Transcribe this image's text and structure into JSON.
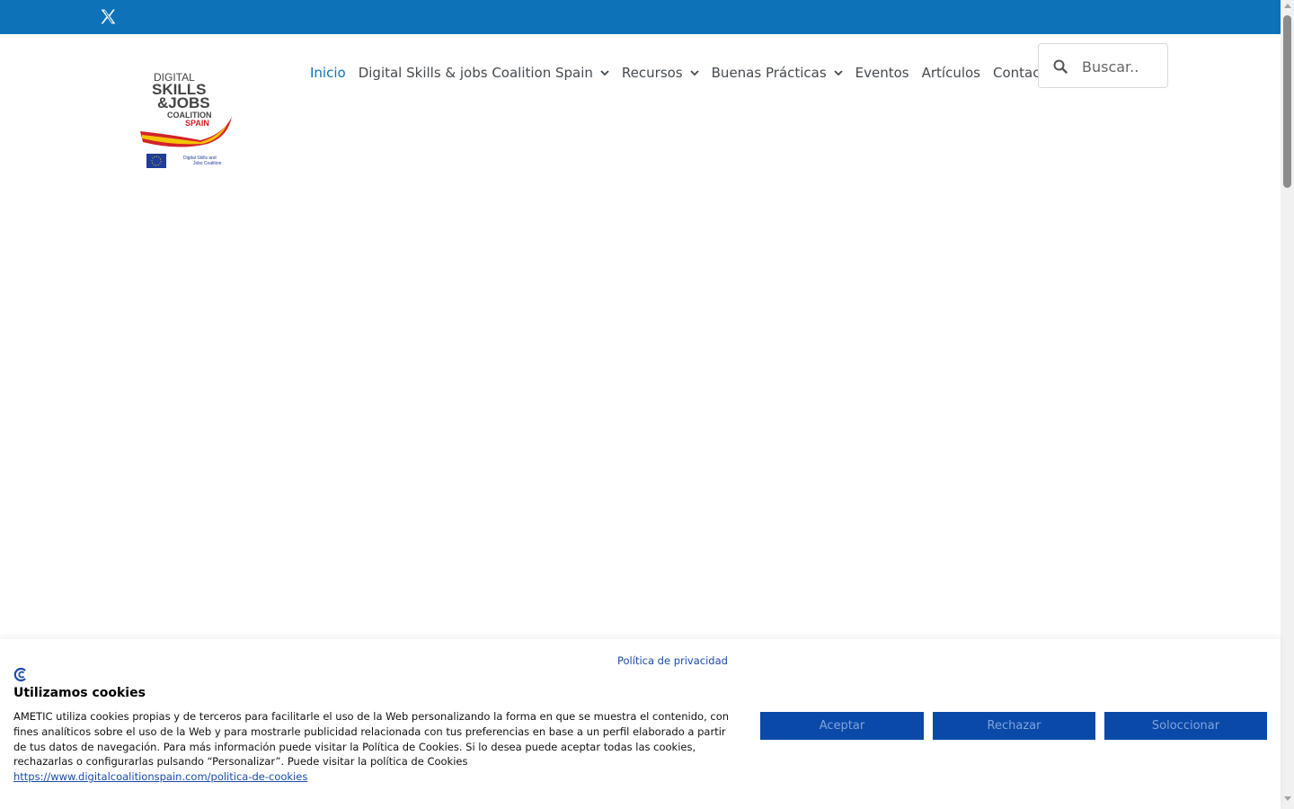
{
  "topbar": {
    "social_icon": "x-twitter-icon",
    "color": "#0e72b9"
  },
  "logo": {
    "line1": "DIGITAL",
    "line2": "SKILLS",
    "line3": "&JOBS",
    "line4": "COALITION",
    "line5": "SPAIN",
    "eu_caption_1": "Digital Skills and",
    "eu_caption_2": "Jobs Coalition"
  },
  "nav": {
    "items": [
      {
        "label": "Inicio",
        "active": true,
        "dropdown": false
      },
      {
        "label": "Digital Skills & jobs Coalition Spain",
        "active": false,
        "dropdown": true
      },
      {
        "label": "Recursos",
        "active": false,
        "dropdown": true
      },
      {
        "label": "Buenas Prácticas",
        "active": false,
        "dropdown": true
      },
      {
        "label": "Eventos",
        "active": false,
        "dropdown": false
      },
      {
        "label": "Artículos",
        "active": false,
        "dropdown": false
      },
      {
        "label": "Contacto",
        "active": false,
        "dropdown": false
      }
    ],
    "active_color": "#0e72b9"
  },
  "search": {
    "placeholder": "Buscar..",
    "value": ""
  },
  "cookie_banner": {
    "privacy_link": "Política de privacidad",
    "title": "Utilizamos cookies",
    "text": "AMETIC utiliza cookies propias y de terceros para facilitarle el uso de la Web personalizando la forma en que se muestra el contenido, con fines analíticos sobre el uso de la Web y para mostrarle publicidad relacionada con tus preferencias en base a un perfil elaborado a partir de tus datos de navegación. Para más información puede visitar la Política de Cookies. Si lo desea puede aceptar todas las cookies, rechazarlas o configurarlas pulsando “Personalizar”. Puede visitar la política de Cookies",
    "url": "https://www.digitalcoalitionspain.com/politica-de-cookies",
    "buttons": {
      "accept": "Aceptar",
      "reject": "Rechazar",
      "select": "Soloccionar"
    },
    "button_color": "#0b49a8"
  }
}
